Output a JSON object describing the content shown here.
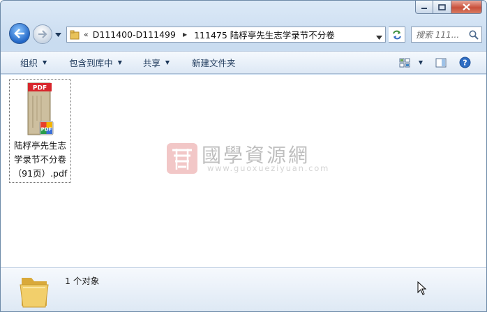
{
  "window": {
    "caption": {
      "minimize": "minimize",
      "maximize": "maximize",
      "close": "close"
    }
  },
  "address_bar": {
    "overflow": "«",
    "segments": [
      "D111400-D111499",
      "111475 陆桴亭先生志学录节不分卷"
    ]
  },
  "search": {
    "placeholder": "搜索 111..."
  },
  "toolbar": {
    "organize": "组织",
    "include_in_library": "包含到库中",
    "share": "共享",
    "new_folder": "新建文件夹"
  },
  "file": {
    "name": "陆桴亭先生志学录节不分卷（91页）.pdf",
    "badge": "PDF"
  },
  "watermark": {
    "title": "國學資源網",
    "url": "www.guoxueziyuan.com"
  },
  "status": {
    "text": "1 个对象"
  },
  "colors": {
    "accent": "#2266c6",
    "pdf_red": "#d8262c",
    "toolbar_text": "#1e395b"
  }
}
